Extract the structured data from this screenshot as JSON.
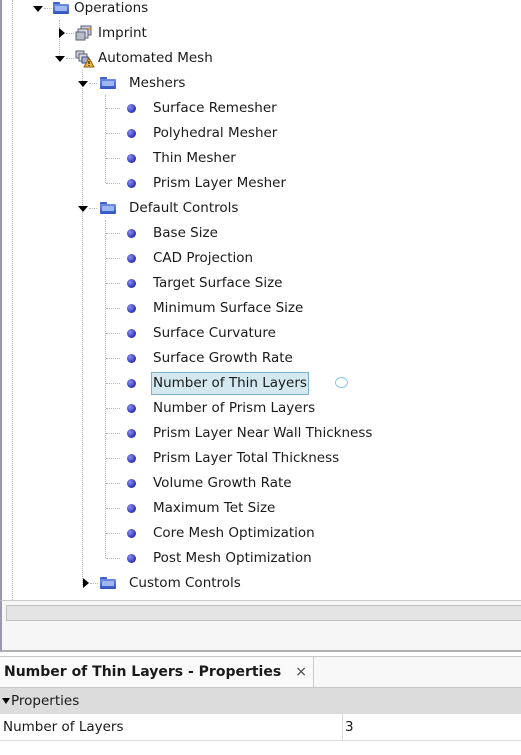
{
  "tree": {
    "operations": {
      "label": "Operations",
      "expanded": true
    },
    "imprint": {
      "label": "Imprint",
      "expanded": false
    },
    "automated_mesh": {
      "label": "Automated Mesh",
      "expanded": true,
      "warning": true
    },
    "meshers": {
      "label": "Meshers",
      "expanded": true,
      "items": [
        "Surface Remesher",
        "Polyhedral Mesher",
        "Thin Mesher",
        "Prism Layer Mesher"
      ]
    },
    "default_controls": {
      "label": "Default Controls",
      "expanded": true,
      "items": [
        "Base Size",
        "CAD Projection",
        "Target Surface Size",
        "Minimum Surface Size",
        "Surface Curvature",
        "Surface Growth Rate",
        "Number of Thin Layers",
        "Number of Prism Layers",
        "Prism Layer Near Wall Thickness",
        "Prism Layer Total Thickness",
        "Volume Growth Rate",
        "Maximum Tet Size",
        "Core Mesh Optimization",
        "Post Mesh Optimization"
      ],
      "selected_index": 6
    },
    "custom_controls": {
      "label": "Custom Controls",
      "expanded": false
    }
  },
  "properties_panel": {
    "tab_title": "Number of Thin Layers - Properties",
    "close_glyph": "×",
    "section_label": "Properties",
    "rows": [
      {
        "name": "Number of Layers",
        "value": "3"
      }
    ]
  }
}
